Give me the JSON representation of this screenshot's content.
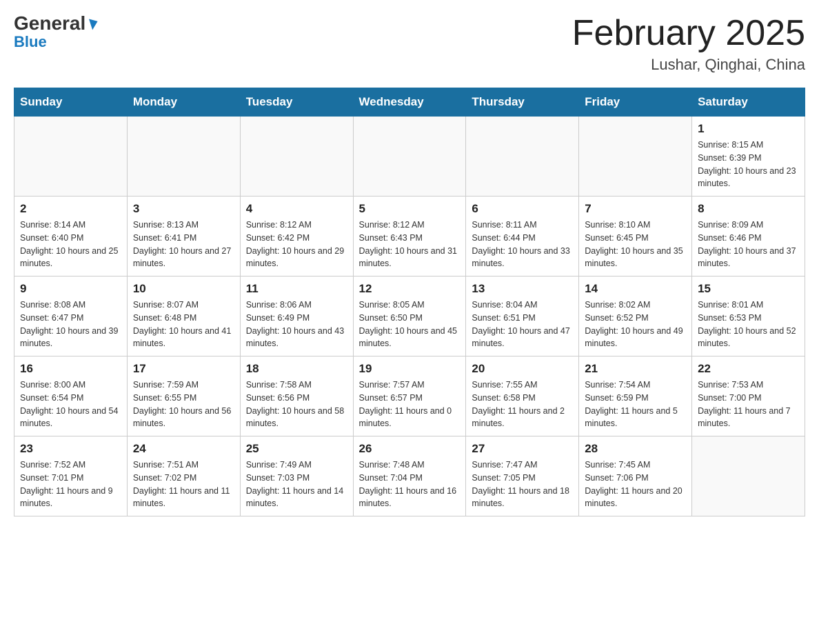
{
  "header": {
    "logo_general": "General",
    "logo_blue": "Blue",
    "month_title": "February 2025",
    "location": "Lushar, Qinghai, China"
  },
  "days_of_week": [
    "Sunday",
    "Monday",
    "Tuesday",
    "Wednesday",
    "Thursday",
    "Friday",
    "Saturday"
  ],
  "weeks": [
    [
      {
        "day": "",
        "info": ""
      },
      {
        "day": "",
        "info": ""
      },
      {
        "day": "",
        "info": ""
      },
      {
        "day": "",
        "info": ""
      },
      {
        "day": "",
        "info": ""
      },
      {
        "day": "",
        "info": ""
      },
      {
        "day": "1",
        "info": "Sunrise: 8:15 AM\nSunset: 6:39 PM\nDaylight: 10 hours and 23 minutes."
      }
    ],
    [
      {
        "day": "2",
        "info": "Sunrise: 8:14 AM\nSunset: 6:40 PM\nDaylight: 10 hours and 25 minutes."
      },
      {
        "day": "3",
        "info": "Sunrise: 8:13 AM\nSunset: 6:41 PM\nDaylight: 10 hours and 27 minutes."
      },
      {
        "day": "4",
        "info": "Sunrise: 8:12 AM\nSunset: 6:42 PM\nDaylight: 10 hours and 29 minutes."
      },
      {
        "day": "5",
        "info": "Sunrise: 8:12 AM\nSunset: 6:43 PM\nDaylight: 10 hours and 31 minutes."
      },
      {
        "day": "6",
        "info": "Sunrise: 8:11 AM\nSunset: 6:44 PM\nDaylight: 10 hours and 33 minutes."
      },
      {
        "day": "7",
        "info": "Sunrise: 8:10 AM\nSunset: 6:45 PM\nDaylight: 10 hours and 35 minutes."
      },
      {
        "day": "8",
        "info": "Sunrise: 8:09 AM\nSunset: 6:46 PM\nDaylight: 10 hours and 37 minutes."
      }
    ],
    [
      {
        "day": "9",
        "info": "Sunrise: 8:08 AM\nSunset: 6:47 PM\nDaylight: 10 hours and 39 minutes."
      },
      {
        "day": "10",
        "info": "Sunrise: 8:07 AM\nSunset: 6:48 PM\nDaylight: 10 hours and 41 minutes."
      },
      {
        "day": "11",
        "info": "Sunrise: 8:06 AM\nSunset: 6:49 PM\nDaylight: 10 hours and 43 minutes."
      },
      {
        "day": "12",
        "info": "Sunrise: 8:05 AM\nSunset: 6:50 PM\nDaylight: 10 hours and 45 minutes."
      },
      {
        "day": "13",
        "info": "Sunrise: 8:04 AM\nSunset: 6:51 PM\nDaylight: 10 hours and 47 minutes."
      },
      {
        "day": "14",
        "info": "Sunrise: 8:02 AM\nSunset: 6:52 PM\nDaylight: 10 hours and 49 minutes."
      },
      {
        "day": "15",
        "info": "Sunrise: 8:01 AM\nSunset: 6:53 PM\nDaylight: 10 hours and 52 minutes."
      }
    ],
    [
      {
        "day": "16",
        "info": "Sunrise: 8:00 AM\nSunset: 6:54 PM\nDaylight: 10 hours and 54 minutes."
      },
      {
        "day": "17",
        "info": "Sunrise: 7:59 AM\nSunset: 6:55 PM\nDaylight: 10 hours and 56 minutes."
      },
      {
        "day": "18",
        "info": "Sunrise: 7:58 AM\nSunset: 6:56 PM\nDaylight: 10 hours and 58 minutes."
      },
      {
        "day": "19",
        "info": "Sunrise: 7:57 AM\nSunset: 6:57 PM\nDaylight: 11 hours and 0 minutes."
      },
      {
        "day": "20",
        "info": "Sunrise: 7:55 AM\nSunset: 6:58 PM\nDaylight: 11 hours and 2 minutes."
      },
      {
        "day": "21",
        "info": "Sunrise: 7:54 AM\nSunset: 6:59 PM\nDaylight: 11 hours and 5 minutes."
      },
      {
        "day": "22",
        "info": "Sunrise: 7:53 AM\nSunset: 7:00 PM\nDaylight: 11 hours and 7 minutes."
      }
    ],
    [
      {
        "day": "23",
        "info": "Sunrise: 7:52 AM\nSunset: 7:01 PM\nDaylight: 11 hours and 9 minutes."
      },
      {
        "day": "24",
        "info": "Sunrise: 7:51 AM\nSunset: 7:02 PM\nDaylight: 11 hours and 11 minutes."
      },
      {
        "day": "25",
        "info": "Sunrise: 7:49 AM\nSunset: 7:03 PM\nDaylight: 11 hours and 14 minutes."
      },
      {
        "day": "26",
        "info": "Sunrise: 7:48 AM\nSunset: 7:04 PM\nDaylight: 11 hours and 16 minutes."
      },
      {
        "day": "27",
        "info": "Sunrise: 7:47 AM\nSunset: 7:05 PM\nDaylight: 11 hours and 18 minutes."
      },
      {
        "day": "28",
        "info": "Sunrise: 7:45 AM\nSunset: 7:06 PM\nDaylight: 11 hours and 20 minutes."
      },
      {
        "day": "",
        "info": ""
      }
    ]
  ]
}
